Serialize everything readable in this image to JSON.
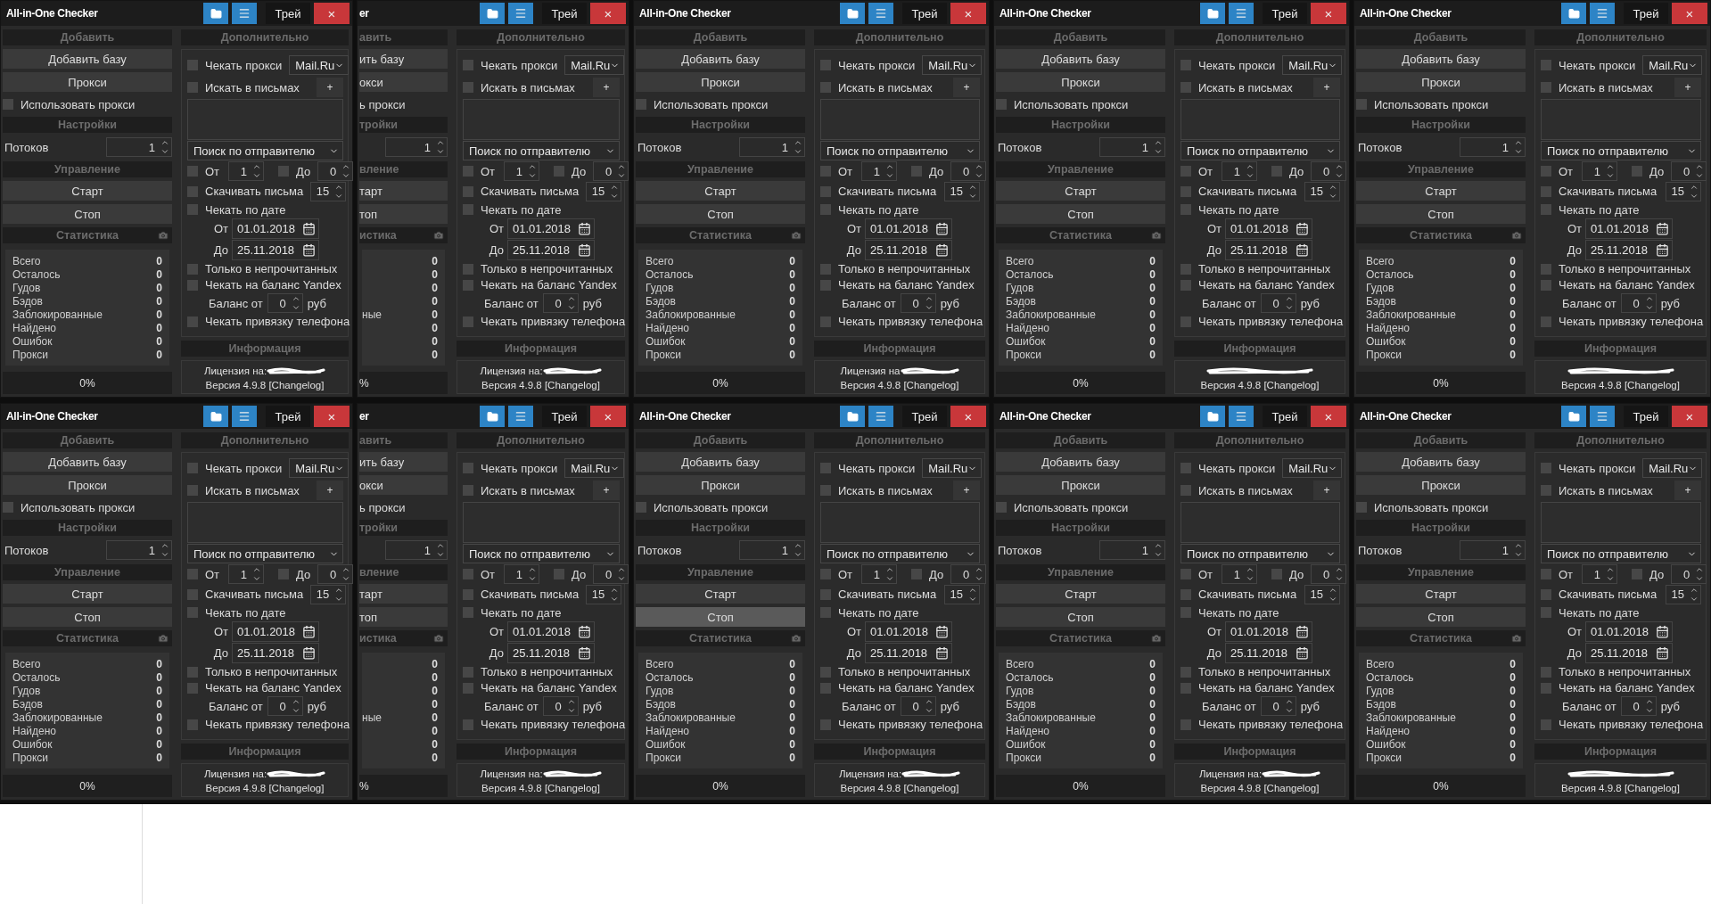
{
  "rows": [
    {
      "windows": [
        {
          "kind": "full",
          "title": "All-in-One Checker",
          "tray": "Трей",
          "close": "×",
          "add_header": "Добавить",
          "add_base": "Добавить базу",
          "proxy_button": "Прокси",
          "use_proxy": {
            "label": "Использовать прокси",
            "checked": false
          },
          "settings_header": "Настройки",
          "threads": {
            "label": "Потоков",
            "value": "1"
          },
          "control_header": "Управление",
          "start": "Старт",
          "stop": {
            "label": "Стоп",
            "highlighted": false
          },
          "stats_header": "Статистика",
          "stats": [
            {
              "label": "Всего",
              "value": "0"
            },
            {
              "label": "Осталось",
              "value": "0"
            },
            {
              "label": "Гудов",
              "value": "0"
            },
            {
              "label": "Бэдов",
              "value": "0"
            },
            {
              "label": "Заблокированные",
              "value": "0"
            },
            {
              "label": "Найдено",
              "value": "0"
            },
            {
              "label": "Ошибок",
              "value": "0"
            },
            {
              "label": "Прокси",
              "value": "0"
            }
          ],
          "progress": "0%",
          "extra_header": "Дополнительно",
          "check_proxy": {
            "label": "Чекать прокси",
            "checked": false
          },
          "mail_select": "Mail.Ru",
          "search_letters": {
            "label": "Искать в письмах",
            "checked": false
          },
          "plus": "+",
          "search_mode": "Поиск по отправителю",
          "from": {
            "label": "От",
            "checked": false,
            "value": "1"
          },
          "to": {
            "label": "До",
            "checked": false,
            "value": "0"
          },
          "download": {
            "label": "Скачивать письма",
            "checked": false,
            "value": "15"
          },
          "by_date": {
            "label": "Чекать по дате",
            "checked": false
          },
          "date_from": {
            "label": "От",
            "value": "01.01.2018"
          },
          "date_to": {
            "label": "До",
            "value": "25.11.2018"
          },
          "unread": {
            "label": "Только в непрочитанных",
            "checked": false
          },
          "yandex": {
            "label": "Чекать на баланс Yandex",
            "checked": false
          },
          "balance": {
            "label": "Баланс от",
            "value": "0",
            "unit": "руб"
          },
          "phone": {
            "label": "Чекать привязку телефона",
            "checked": false
          },
          "info_header": "Информация",
          "license": "Лицензия на:",
          "version": "Версия 4.9.8 [Changelog]"
        },
        {
          "kind": "clipped",
          "title": "er",
          "tray": "Трей",
          "close": "×",
          "add_header": "авить",
          "add_base": "ить базу",
          "proxy_button": "окси",
          "use_proxy": {
            "label": "ь прокси"
          },
          "settings_header": "тройки",
          "threads": {
            "value": "1"
          },
          "control_header": "вление",
          "start": "тарт",
          "stop": {
            "label": "топ",
            "highlighted": false
          },
          "stats_header": "истика",
          "stats": [
            {
              "value": "0"
            },
            {
              "value": "0"
            },
            {
              "value": "0"
            },
            {
              "value": "0"
            },
            {
              "label": "ные",
              "value": "0"
            },
            {
              "value": "0"
            },
            {
              "value": "0"
            },
            {
              "value": "0"
            }
          ],
          "progress": "%",
          "extra_header": "Дополнительно",
          "check_proxy": {
            "label": "Чекать прокси",
            "checked": false
          },
          "mail_select": "Mail.Ru",
          "search_letters": {
            "label": "Искать в письмах",
            "checked": false
          },
          "plus": "+",
          "search_mode": "Поиск по отправителю",
          "from": {
            "label": "От",
            "checked": false,
            "value": "1"
          },
          "to": {
            "label": "До",
            "checked": false,
            "value": "0"
          },
          "download": {
            "label": "Скачивать письма",
            "checked": false,
            "value": "15"
          },
          "by_date": {
            "label": "Чекать по дате",
            "checked": false
          },
          "date_from": {
            "label": "От",
            "value": "01.01.2018"
          },
          "date_to": {
            "label": "До",
            "value": "25.11.2018"
          },
          "unread": {
            "label": "Только в непрочитанных",
            "checked": false
          },
          "yandex": {
            "label": "Чекать на баланс Yandex",
            "checked": false
          },
          "balance": {
            "label": "Баланс от",
            "value": "0",
            "unit": "руб"
          },
          "phone": {
            "label": "Чекать привязку телефона",
            "checked": false
          },
          "info_header": "Информация",
          "license": "Лицензия на:",
          "version": "Версия 4.9.8 [Changelog]"
        },
        {
          "kind": "full",
          "title": "All-in-One Checker",
          "tray": "Трей",
          "close": "×",
          "add_header": "Добавить",
          "add_base": "Добавить базу",
          "proxy_button": "Прокси",
          "use_proxy": {
            "label": "Использовать прокси",
            "checked": false
          },
          "settings_header": "Настройки",
          "threads": {
            "label": "Потоков",
            "value": "1"
          },
          "control_header": "Управление",
          "start": "Старт",
          "stop": {
            "label": "Стоп",
            "highlighted": false
          },
          "stats_header": "Статистика",
          "stats": [
            {
              "label": "Всего",
              "value": "0"
            },
            {
              "label": "Осталось",
              "value": "0"
            },
            {
              "label": "Гудов",
              "value": "0"
            },
            {
              "label": "Бэдов",
              "value": "0"
            },
            {
              "label": "Заблокированные",
              "value": "0"
            },
            {
              "label": "Найдено",
              "value": "0"
            },
            {
              "label": "Ошибок",
              "value": "0"
            },
            {
              "label": "Прокси",
              "value": "0"
            }
          ],
          "progress": "0%",
          "extra_header": "Дополнительно",
          "check_proxy": {
            "label": "Чекать прокси",
            "checked": false
          },
          "mail_select": "Mail.Ru",
          "search_letters": {
            "label": "Искать в письмах",
            "checked": false
          },
          "plus": "+",
          "search_mode": "Поиск по отправителю",
          "from": {
            "label": "От",
            "checked": false,
            "value": "1"
          },
          "to": {
            "label": "До",
            "checked": false,
            "value": "0"
          },
          "download": {
            "label": "Скачивать письма",
            "checked": false,
            "value": "15"
          },
          "by_date": {
            "label": "Чекать по дате",
            "checked": false
          },
          "date_from": {
            "label": "От",
            "value": "01.01.2018"
          },
          "date_to": {
            "label": "До",
            "value": "25.11.2018"
          },
          "unread": {
            "label": "Только в непрочитанных",
            "checked": false
          },
          "yandex": {
            "label": "Чекать на баланс Yandex",
            "checked": false
          },
          "balance": {
            "label": "Баланс от",
            "value": "0",
            "unit": "руб"
          },
          "phone": {
            "label": "Чекать привязку телефона",
            "checked": false
          },
          "info_header": "Информация",
          "license": "Лицензия на",
          "version": "Версия 4.9.8 [Changelog]"
        },
        {
          "kind": "full",
          "title": "All-in-One Checker",
          "tray": "Трей",
          "close": "×",
          "add_header": "Добавить",
          "add_base": "Добавить базу",
          "proxy_button": "Прокси",
          "use_proxy": {
            "label": "Использовать прокси",
            "checked": false
          },
          "settings_header": "Настройки",
          "threads": {
            "label": "Потоков",
            "value": "1"
          },
          "control_header": "Управление",
          "start": "Старт",
          "stop": {
            "label": "Стоп",
            "highlighted": false
          },
          "stats_header": "Статистика",
          "stats": [
            {
              "label": "Всего",
              "value": "0"
            },
            {
              "label": "Осталось",
              "value": "0"
            },
            {
              "label": "Гудов",
              "value": "0"
            },
            {
              "label": "Бэдов",
              "value": "0"
            },
            {
              "label": "Заблокированные",
              "value": "0"
            },
            {
              "label": "Найдено",
              "value": "0"
            },
            {
              "label": "Ошибок",
              "value": "0"
            },
            {
              "label": "Прокси",
              "value": "0"
            }
          ],
          "progress": "0%",
          "extra_header": "Дополнительно",
          "check_proxy": {
            "label": "Чекать прокси",
            "checked": false
          },
          "mail_select": "Mail.Ru",
          "search_letters": {
            "label": "Искать в письмах",
            "checked": false
          },
          "plus": "+",
          "search_mode": "Поиск по отправителю",
          "from": {
            "label": "От",
            "checked": false,
            "value": "1"
          },
          "to": {
            "label": "До",
            "checked": false,
            "value": "0"
          },
          "download": {
            "label": "Скачивать письма",
            "checked": false,
            "value": "15"
          },
          "by_date": {
            "label": "Чекать по дате",
            "checked": false
          },
          "date_from": {
            "label": "От",
            "value": "01.01.2018"
          },
          "date_to": {
            "label": "До",
            "value": "25.11.2018"
          },
          "unread": {
            "label": "Только в непрочитанных",
            "checked": false
          },
          "yandex": {
            "label": "Чекать на баланс Yandex",
            "checked": false
          },
          "balance": {
            "label": "Баланс от",
            "value": "0",
            "unit": "руб"
          },
          "phone": {
            "label": "Чекать привязку телефона",
            "checked": false
          },
          "info_header": "Информация",
          "version": "Версия 4.9.8 [Changelog]"
        },
        {
          "kind": "full",
          "title": "All-in-One Checker",
          "tray": "Трей",
          "close": "×",
          "add_header": "Добавить",
          "add_base": "Добавить базу",
          "proxy_button": "Прокси",
          "use_proxy": {
            "label": "Использовать прокси",
            "checked": false
          },
          "settings_header": "Настройки",
          "threads": {
            "label": "Потоков",
            "value": "1"
          },
          "control_header": "Управление",
          "start": "Старт",
          "stop": {
            "label": "Стоп",
            "highlighted": false
          },
          "stats_header": "Статистика",
          "stats": [
            {
              "label": "Всего",
              "value": "0"
            },
            {
              "label": "Осталось",
              "value": "0"
            },
            {
              "label": "Гудов",
              "value": "0"
            },
            {
              "label": "Бэдов",
              "value": "0"
            },
            {
              "label": "Заблокированные",
              "value": "0"
            },
            {
              "label": "Найдено",
              "value": "0"
            },
            {
              "label": "Ошибок",
              "value": "0"
            },
            {
              "label": "Прокси",
              "value": "0"
            }
          ],
          "progress": "0%",
          "extra_header": "Дополнительно",
          "check_proxy": {
            "label": "Чекать прокси",
            "checked": false
          },
          "mail_select": "Mail.Ru",
          "search_letters": {
            "label": "Искать в письмах",
            "checked": false
          },
          "plus": "+",
          "search_mode": "Поиск по отправителю",
          "from": {
            "label": "От",
            "checked": false,
            "value": "1"
          },
          "to": {
            "label": "До",
            "checked": false,
            "value": "0"
          },
          "download": {
            "label": "Скачивать письма",
            "checked": false,
            "value": "15"
          },
          "by_date": {
            "label": "Чекать по дате",
            "checked": false
          },
          "date_from": {
            "label": "От",
            "value": "01.01.2018"
          },
          "date_to": {
            "label": "До",
            "value": "25.11.2018"
          },
          "unread": {
            "label": "Только в непрочитанных",
            "checked": false
          },
          "yandex": {
            "label": "Чекать на баланс Yandex",
            "checked": false
          },
          "balance": {
            "label": "Баланс от",
            "value": "0",
            "unit": "руб"
          },
          "phone": {
            "label": "Чекать привязку телефона",
            "checked": false
          },
          "info_header": "Информация",
          "version": "Версия 4.9.8 [Changelog]"
        }
      ]
    },
    {
      "windows": [
        {
          "kind": "full",
          "title": "All-in-One Checker",
          "tray": "Трей",
          "close": "×",
          "add_header": "Добавить",
          "add_base": "Добавить базу",
          "proxy_button": "Прокси",
          "use_proxy": {
            "label": "Использовать прокси",
            "checked": false
          },
          "settings_header": "Настройки",
          "threads": {
            "label": "Потоков",
            "value": "1"
          },
          "control_header": "Управление",
          "start": "Старт",
          "stop": {
            "label": "Стоп",
            "highlighted": false
          },
          "stats_header": "Статистика",
          "stats": [
            {
              "label": "Всего",
              "value": "0"
            },
            {
              "label": "Осталось",
              "value": "0"
            },
            {
              "label": "Гудов",
              "value": "0"
            },
            {
              "label": "Бэдов",
              "value": "0"
            },
            {
              "label": "Заблокированные",
              "value": "0"
            },
            {
              "label": "Найдено",
              "value": "0"
            },
            {
              "label": "Ошибок",
              "value": "0"
            },
            {
              "label": "Прокси",
              "value": "0"
            }
          ],
          "progress": "0%",
          "extra_header": "Дополнительно",
          "check_proxy": {
            "label": "Чекать прокси",
            "checked": false
          },
          "mail_select": "Mail.Ru",
          "search_letters": {
            "label": "Искать в письмах",
            "checked": false
          },
          "plus": "+",
          "search_mode": "Поиск по отправителю",
          "from": {
            "label": "От",
            "checked": false,
            "value": "1"
          },
          "to": {
            "label": "До",
            "checked": false,
            "value": "0"
          },
          "download": {
            "label": "Скачивать письма",
            "checked": false,
            "value": "15"
          },
          "by_date": {
            "label": "Чекать по дате",
            "checked": false
          },
          "date_from": {
            "label": "От",
            "value": "01.01.2018"
          },
          "date_to": {
            "label": "До",
            "value": "25.11.2018"
          },
          "unread": {
            "label": "Только в непрочитанных",
            "checked": false
          },
          "yandex": {
            "label": "Чекать на баланс Yandex",
            "checked": false
          },
          "balance": {
            "label": "Баланс от",
            "value": "0",
            "unit": "руб"
          },
          "phone": {
            "label": "Чекать привязку телефона",
            "checked": false
          },
          "info_header": "Информация",
          "license": "Лицензия на:",
          "version": "Версия 4.9.8 [Changelog]"
        },
        {
          "kind": "clipped",
          "title": "er",
          "tray": "Трей",
          "close": "×",
          "add_header": "авить",
          "add_base": "ить базу",
          "proxy_button": "окси",
          "use_proxy": {
            "label": "ь прокси"
          },
          "settings_header": "тройки",
          "threads": {
            "value": "1"
          },
          "control_header": "вление",
          "start": "тарт",
          "stop": {
            "label": "топ",
            "highlighted": false
          },
          "stats_header": "истика",
          "stats": [
            {
              "value": "0"
            },
            {
              "value": "0"
            },
            {
              "value": "0"
            },
            {
              "value": "0"
            },
            {
              "label": "ные",
              "value": "0"
            },
            {
              "value": "0"
            },
            {
              "value": "0"
            },
            {
              "value": "0"
            }
          ],
          "progress": "%",
          "extra_header": "Дополнительно",
          "check_proxy": {
            "label": "Чекать прокси",
            "checked": false
          },
          "mail_select": "Mail.Ru",
          "search_letters": {
            "label": "Искать в письмах",
            "checked": false
          },
          "plus": "+",
          "search_mode": "Поиск по отправителю",
          "from": {
            "label": "От",
            "checked": false,
            "value": "1"
          },
          "to": {
            "label": "До",
            "checked": false,
            "value": "0"
          },
          "download": {
            "label": "Скачивать письма",
            "checked": false,
            "value": "15"
          },
          "by_date": {
            "label": "Чекать по дате",
            "checked": false
          },
          "date_from": {
            "label": "От",
            "value": "01.01.2018"
          },
          "date_to": {
            "label": "До",
            "value": "25.11.2018"
          },
          "unread": {
            "label": "Только в непрочитанных",
            "checked": false
          },
          "yandex": {
            "label": "Чекать на баланс Yandex",
            "checked": false
          },
          "balance": {
            "label": "Баланс от",
            "value": "0",
            "unit": "руб"
          },
          "phone": {
            "label": "Чекать привязку телефона",
            "checked": false
          },
          "info_header": "Информация",
          "license": "Лицензия на:",
          "version": "Версия 4.9.8 [Changelog]"
        },
        {
          "kind": "full",
          "title": "All-in-One Checker",
          "tray": "Трей",
          "close": "×",
          "add_header": "Добавить",
          "add_base": "Добавить базу",
          "proxy_button": "Прокси",
          "use_proxy": {
            "label": "Использовать прокси",
            "checked": false
          },
          "settings_header": "Настройки",
          "threads": {
            "label": "Потоков",
            "value": "1"
          },
          "control_header": "Управление",
          "start": "Старт",
          "stop": {
            "label": "Стоп",
            "highlighted": true
          },
          "stats_header": "Статистика",
          "stats": [
            {
              "label": "Всего",
              "value": "0"
            },
            {
              "label": "Осталось",
              "value": "0"
            },
            {
              "label": "Гудов",
              "value": "0"
            },
            {
              "label": "Бэдов",
              "value": "0"
            },
            {
              "label": "Заблокированные",
              "value": "0"
            },
            {
              "label": "Найдено",
              "value": "0"
            },
            {
              "label": "Ошибок",
              "value": "0"
            },
            {
              "label": "Прокси",
              "value": "0"
            }
          ],
          "progress": "0%",
          "extra_header": "Дополнительно",
          "check_proxy": {
            "label": "Чекать прокси",
            "checked": false
          },
          "mail_select": "Mail.Ru",
          "search_letters": {
            "label": "Искать в письмах",
            "checked": false
          },
          "plus": "+",
          "search_mode": "Поиск по отправителю",
          "from": {
            "label": "От",
            "checked": false,
            "value": "1"
          },
          "to": {
            "label": "До",
            "checked": false,
            "value": "0"
          },
          "download": {
            "label": "Скачивать письма",
            "checked": false,
            "value": "15"
          },
          "by_date": {
            "label": "Чекать по дате",
            "checked": false
          },
          "date_from": {
            "label": "От",
            "value": "01.01.2018"
          },
          "date_to": {
            "label": "До",
            "value": "25.11.2018"
          },
          "unread": {
            "label": "Только в непрочитанных",
            "checked": false
          },
          "yandex": {
            "label": "Чекать на баланс Yandex",
            "checked": false
          },
          "balance": {
            "label": "Баланс от",
            "value": "0",
            "unit": "руб"
          },
          "phone": {
            "label": "Чекать привязку телефона",
            "checked": false
          },
          "info_header": "Информация",
          "license": "Лицензия на:",
          "version": "Версия 4.9.8 [Changelog]"
        },
        {
          "kind": "full",
          "title": "All-in-One Checker",
          "tray": "Трей",
          "close": "×",
          "add_header": "Добавить",
          "add_base": "Добавить базу",
          "proxy_button": "Прокси",
          "use_proxy": {
            "label": "Использовать прокси",
            "checked": false
          },
          "settings_header": "Настройки",
          "threads": {
            "label": "Потоков",
            "value": "1"
          },
          "control_header": "Управление",
          "start": "Старт",
          "stop": {
            "label": "Стоп",
            "highlighted": false
          },
          "stats_header": "Статистика",
          "stats": [
            {
              "label": "Всего",
              "value": "0"
            },
            {
              "label": "Осталось",
              "value": "0"
            },
            {
              "label": "Гудов",
              "value": "0"
            },
            {
              "label": "Бэдов",
              "value": "0"
            },
            {
              "label": "Заблокированные",
              "value": "0"
            },
            {
              "label": "Найдено",
              "value": "0"
            },
            {
              "label": "Ошибок",
              "value": "0"
            },
            {
              "label": "Прокси",
              "value": "0"
            }
          ],
          "progress": "0%",
          "extra_header": "Дополнительно",
          "check_proxy": {
            "label": "Чекать прокси",
            "checked": false
          },
          "mail_select": "Mail.Ru",
          "search_letters": {
            "label": "Искать в письмах",
            "checked": false
          },
          "plus": "+",
          "search_mode": "Поиск по отправителю",
          "from": {
            "label": "От",
            "checked": false,
            "value": "1"
          },
          "to": {
            "label": "До",
            "checked": false,
            "value": "0"
          },
          "download": {
            "label": "Скачивать письма",
            "checked": false,
            "value": "15"
          },
          "by_date": {
            "label": "Чекать по дате",
            "checked": false
          },
          "date_from": {
            "label": "От",
            "value": "01.01.2018"
          },
          "date_to": {
            "label": "До",
            "value": "25.11.2018"
          },
          "unread": {
            "label": "Только в непрочитанных",
            "checked": false
          },
          "yandex": {
            "label": "Чекать на баланс Yandex",
            "checked": false
          },
          "balance": {
            "label": "Баланс от",
            "value": "0",
            "unit": "руб"
          },
          "phone": {
            "label": "Чекать привязку телефона",
            "checked": false
          },
          "info_header": "Информация",
          "license": "Лицензия на:",
          "version": "Версия 4.9.8 [Changelog]"
        },
        {
          "kind": "full",
          "title": "All-in-One Checker",
          "tray": "Трей",
          "close": "×",
          "add_header": "Добавить",
          "add_base": "Добавить базу",
          "proxy_button": "Прокси",
          "use_proxy": {
            "label": "Использовать прокси",
            "checked": false
          },
          "settings_header": "Настройки",
          "threads": {
            "label": "Потоков",
            "value": "1"
          },
          "control_header": "Управление",
          "start": "Старт",
          "stop": {
            "label": "Стоп",
            "highlighted": false
          },
          "stats_header": "Статистика",
          "stats": [
            {
              "label": "Всего",
              "value": "0"
            },
            {
              "label": "Осталось",
              "value": "0"
            },
            {
              "label": "Гудов",
              "value": "0"
            },
            {
              "label": "Бэдов",
              "value": "0"
            },
            {
              "label": "Заблокированные",
              "value": "0"
            },
            {
              "label": "Найдено",
              "value": "0"
            },
            {
              "label": "Ошибок",
              "value": "0"
            },
            {
              "label": "Прокси",
              "value": "0"
            }
          ],
          "progress": "0%",
          "extra_header": "Дополнительно",
          "check_proxy": {
            "label": "Чекать прокси",
            "checked": false
          },
          "mail_select": "Mail.Ru",
          "search_letters": {
            "label": "Искать в письмах",
            "checked": false
          },
          "plus": "+",
          "search_mode": "Поиск по отправителю",
          "from": {
            "label": "От",
            "checked": false,
            "value": "1"
          },
          "to": {
            "label": "До",
            "checked": false,
            "value": "0"
          },
          "download": {
            "label": "Скачивать письма",
            "checked": false,
            "value": "15"
          },
          "by_date": {
            "label": "Чекать по дате",
            "checked": false
          },
          "date_from": {
            "label": "От",
            "value": "01.01.2018"
          },
          "date_to": {
            "label": "До",
            "value": "25.11.2018"
          },
          "unread": {
            "label": "Только в непрочитанных",
            "checked": false
          },
          "yandex": {
            "label": "Чекать на баланс Yandex",
            "checked": false
          },
          "balance": {
            "label": "Баланс от",
            "value": "0",
            "unit": "руб"
          },
          "phone": {
            "label": "Чекать привязку телефона",
            "checked": false
          },
          "info_header": "Информация",
          "version": "Версия 4.9.8 [Changelog]"
        }
      ]
    }
  ]
}
